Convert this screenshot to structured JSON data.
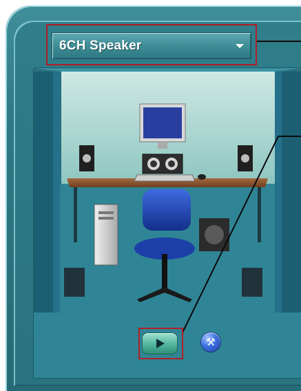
{
  "speaker_config": {
    "selected": "6CH Speaker"
  },
  "icons": {
    "dropdown_arrow": "chevron-down-icon",
    "play": "play-icon",
    "config": "wrench-icon"
  },
  "colors": {
    "frame": "#2f7e8a",
    "callout": "#b01e25",
    "play_button": "#57b9a0",
    "config_button": "#3c6fe0"
  }
}
